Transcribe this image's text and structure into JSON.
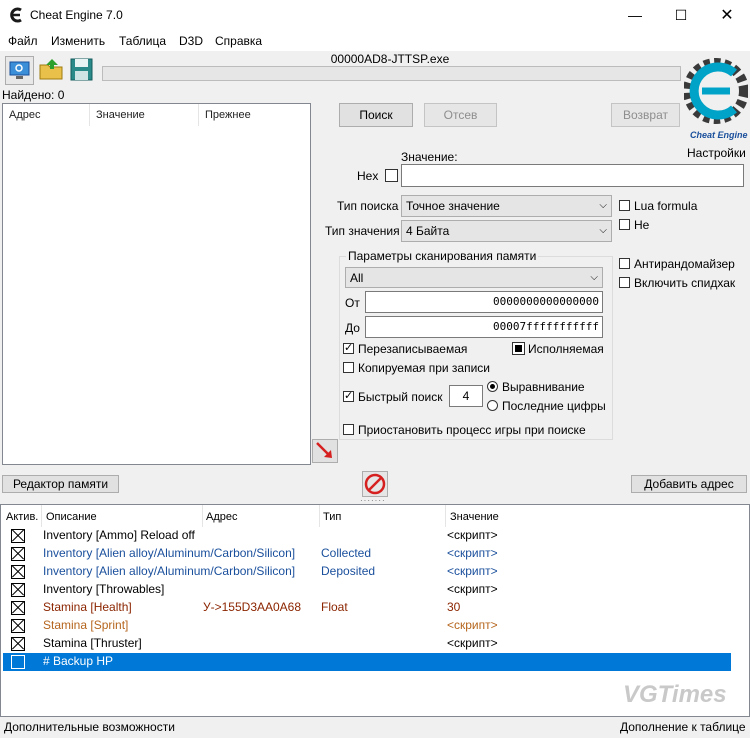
{
  "window": {
    "title": "Cheat Engine 7.0"
  },
  "menu": [
    "Файл",
    "Изменить",
    "Таблица",
    "D3D",
    "Справка"
  ],
  "process_name": "00000AD8-JTTSP.exe",
  "found_label": "Найдено: 0",
  "results_columns": [
    "Адрес",
    "Значение",
    "Прежнее"
  ],
  "buttons": {
    "first_scan": "Поиск",
    "next_scan": "Отсев",
    "undo_scan": "Возврат",
    "memory_view": "Редактор памяти",
    "add_address": "Добавить адрес"
  },
  "logo_label": "Cheat Engine",
  "settings_label": "Настройки",
  "value_label": "Значение:",
  "hex_label": "Hex",
  "scan_type": {
    "label": "Тип поиска",
    "selected": "Точное значение"
  },
  "value_type": {
    "label": "Тип значения",
    "selected": "4 Байта"
  },
  "lua_formula": "Lua formula",
  "not_label": "Не",
  "memory_scan": {
    "title": "Параметры сканирования памяти",
    "region": "All",
    "from_label": "От",
    "from_value": "0000000000000000",
    "to_label": "До",
    "to_value": "00007fffffffffff",
    "writable": "Перезаписываемая",
    "executable": "Исполняемая",
    "copy_on_write": "Копируемая при записи",
    "fast_scan": "Быстрый поиск",
    "fast_scan_value": "4",
    "alignment": "Выравнивание",
    "last_digits": "Последние цифры",
    "pause_game": "Приостановить процесс игры при поиске"
  },
  "unrandomizer": "Антирандомайзер",
  "speedhack": "Включить спидхак",
  "table_columns": [
    "Актив.",
    "Описание",
    "Адрес",
    "Тип",
    "Значение"
  ],
  "table_rows": [
    {
      "desc": "Inventory   [Ammo]   Reload off",
      "address": "",
      "type": "",
      "value": "<скрипт>",
      "color": "#000000"
    },
    {
      "desc": "Inventory   [Alien alloy/Aluminum/Carbon/Silicon]",
      "address": "",
      "type": "Collected",
      "value": "<скрипт>",
      "color": "#1a4f9c"
    },
    {
      "desc": "Inventory   [Alien alloy/Aluminum/Carbon/Silicon]",
      "address": "",
      "type": "Deposited",
      "value": "<скрипт>",
      "color": "#1a4f9c"
    },
    {
      "desc": "Inventory   [Throwables]",
      "address": "",
      "type": "",
      "value": "<скрипт>",
      "color": "#000000"
    },
    {
      "desc": "Stamina   [Health]",
      "address": "У->155D3AA0A68",
      "type": "Float",
      "value": "30",
      "color": "#8b2500"
    },
    {
      "desc": "Stamina   [Sprint]",
      "address": "",
      "type": "",
      "value": "<скрипт>",
      "color": "#b5651d"
    },
    {
      "desc": "Stamina   [Thruster]",
      "address": "",
      "type": "",
      "value": "<скрипт>",
      "color": "#000000"
    },
    {
      "desc": "# Backup HP",
      "address": "",
      "type": "",
      "value": "",
      "color": "#ffffff"
    }
  ],
  "watermark": "VGTimes",
  "status": {
    "left": "Дополнительные возможности",
    "right": "Дополнение к таблице"
  },
  "colors": {
    "selection": "#0078d7",
    "logo": "#00a3c8"
  }
}
